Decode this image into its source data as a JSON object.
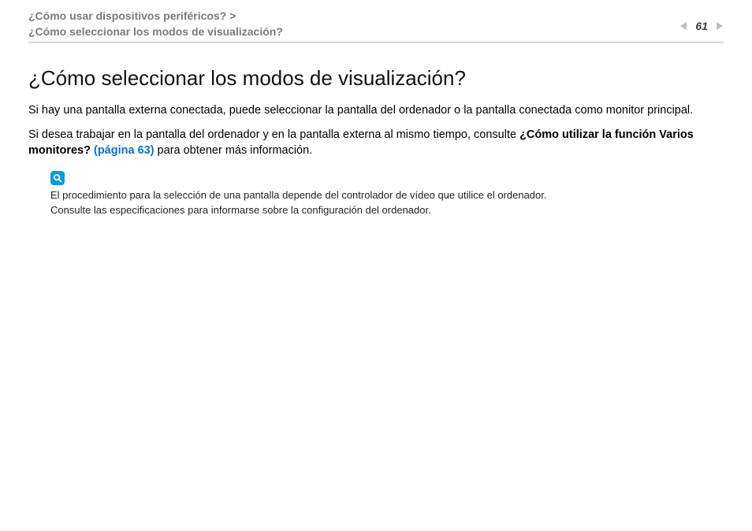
{
  "header": {
    "breadcrumb_parent": "¿Cómo usar dispositivos periféricos?",
    "breadcrumb_sep": " > ",
    "breadcrumb_current": "¿Cómo seleccionar los modos de visualización?",
    "page_number": "61",
    "back_icon": "back-arrow",
    "next_icon": "next-arrow"
  },
  "content": {
    "title": "¿Cómo seleccionar los modos de visualización?",
    "p1": "Si hay una pantalla externa conectada, puede seleccionar la pantalla del ordenador o la pantalla conectada como monitor principal.",
    "p2_lead": "Si desea trabajar en la pantalla del ordenador y en la pantalla externa al mismo tiempo, consulte ",
    "p2_bold": "¿Cómo utilizar la función Varios monitores? ",
    "p2_link": "(página 63)",
    "p2_tail": " para obtener más información."
  },
  "note": {
    "icon": "magnifier-icon",
    "line1": "El procedimiento para la selección de una pantalla depende del controlador de vídeo que utilice el ordenador.",
    "line2": "Consulte las especificaciones para informarse sobre la configuración del ordenador."
  }
}
